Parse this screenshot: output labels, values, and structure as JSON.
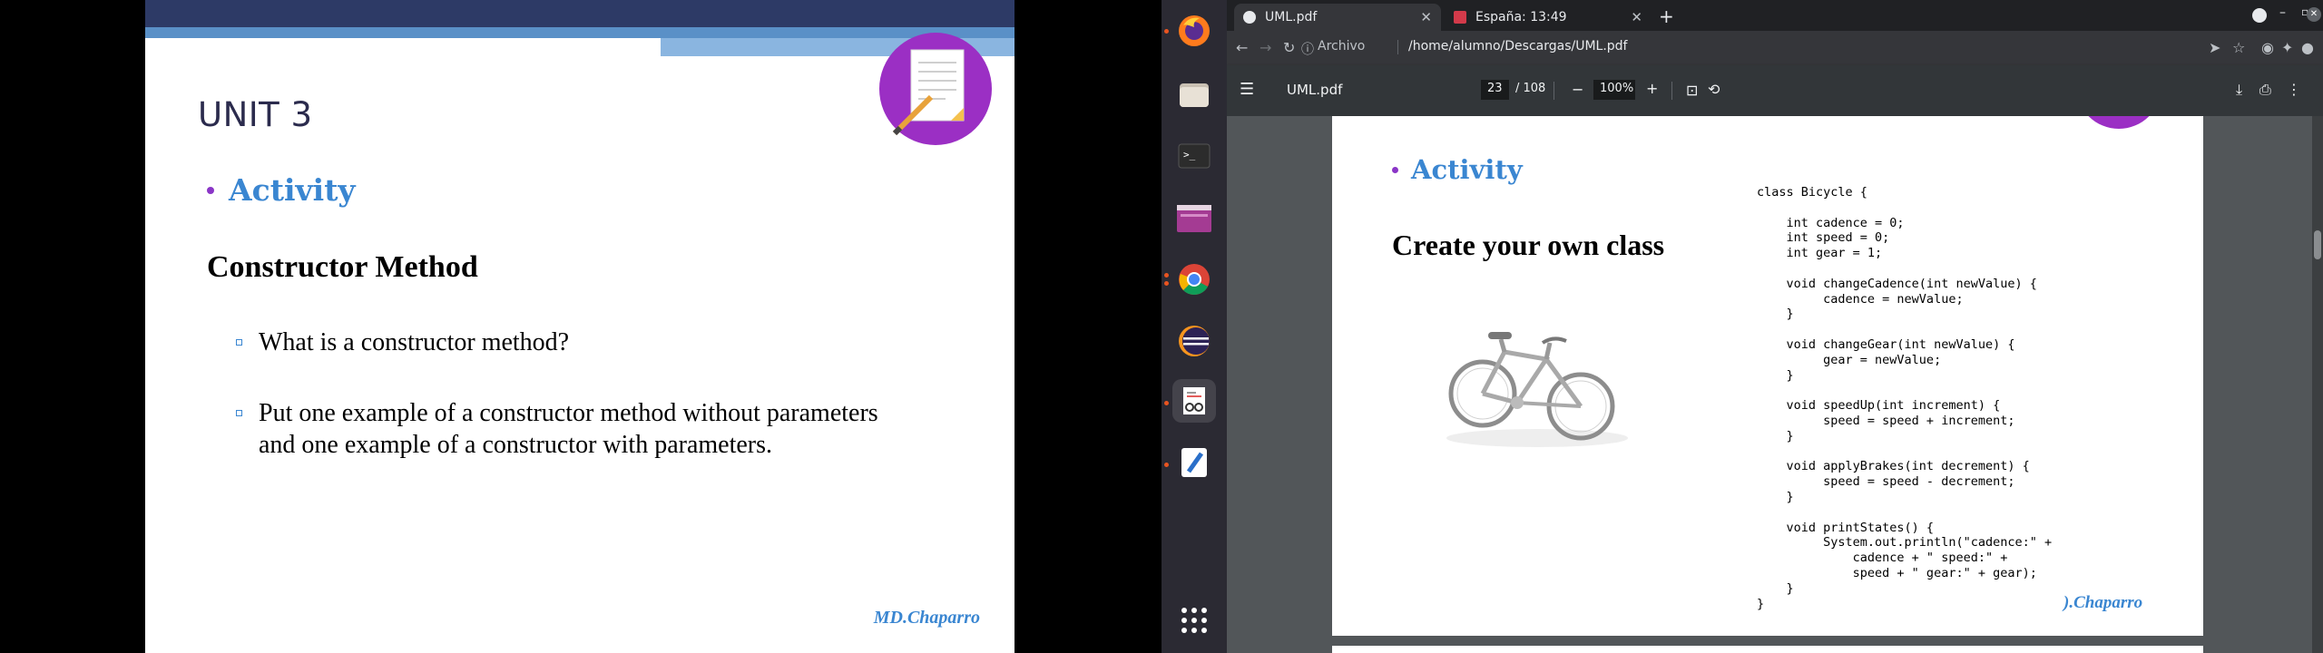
{
  "slide": {
    "title": "UNIT 3",
    "bullet": "Activity",
    "heading": "Constructor Method",
    "questions": [
      "What is a constructor method?",
      "Put one example of a constructor method without parameters and one example of a constructor with parameters."
    ],
    "signature": "MD.Chaparro"
  },
  "dock": {
    "items": [
      {
        "name": "firefox"
      },
      {
        "name": "files"
      },
      {
        "name": "terminal"
      },
      {
        "name": "app-menu-window"
      },
      {
        "name": "chrome"
      },
      {
        "name": "eclipse"
      },
      {
        "name": "document-viewer"
      },
      {
        "name": "text-editor"
      },
      {
        "name": "show-applications"
      }
    ]
  },
  "browser": {
    "tabs": [
      {
        "title": "UML.pdf",
        "active": true
      },
      {
        "title": "España: 13:49",
        "active": false
      }
    ],
    "new_tab": "+",
    "address_label": "Archivo",
    "address": "/home/alumno/Descargas/UML.pdf"
  },
  "pdf": {
    "filename": "UML.pdf",
    "current_page": "23",
    "total_pages": "/ 108",
    "zoom": "100%",
    "bullet": "Activity",
    "heading": "Create your own class",
    "code": "class Bicycle {\n\n    int cadence = 0;\n    int speed = 0;\n    int gear = 1;\n\n    void changeCadence(int newValue) {\n         cadence = newValue;\n    }\n\n    void changeGear(int newValue) {\n         gear = newValue;\n    }\n\n    void speedUp(int increment) {\n         speed = speed + increment;\n    }\n\n    void applyBrakes(int decrement) {\n         speed = speed - decrement;\n    }\n\n    void printStates() {\n         System.out.println(\"cadence:\" +\n             cadence + \" speed:\" +\n             speed + \" gear:\" + gear);\n    }\n}",
    "signature": ").Chaparro"
  },
  "colors": {
    "accent_blue": "#3a86d1",
    "bullet_purple": "#8a35c7",
    "dock_bg": "#2b2a33",
    "browser_dark": "#202124"
  }
}
